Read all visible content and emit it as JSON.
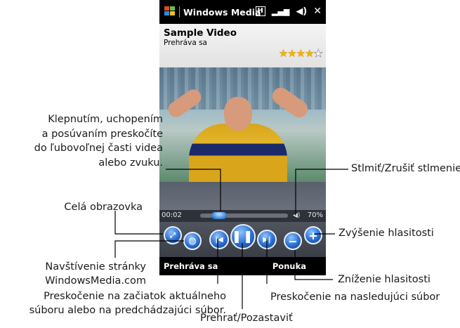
{
  "titlebar": {
    "app_name": "Windows Media",
    "close_glyph": "✕"
  },
  "media": {
    "title": "Sample Video",
    "status": "Prehráva sa",
    "rating": 4,
    "rating_max": 5
  },
  "playback": {
    "elapsed": "00:02",
    "volume_label": "70%",
    "volume": 0.7
  },
  "softkeys": {
    "left": "Prehráva sa",
    "right": "Ponuka"
  },
  "callouts": {
    "seek": [
      "Klepnutím, uchopením",
      "a posúvaním preskočíte",
      "do ľubovoľnej časti videa",
      "alebo zvuku."
    ],
    "fullscreen": "Celá obrazovka",
    "website": [
      "Navštívenie stránky",
      "WindowsMedia.com"
    ],
    "previous": [
      "Preskočenie na začiatok aktuálneho",
      "súboru alebo na predchádzajúci súbor."
    ],
    "play_pause": "Prehrať/Pozastaviť",
    "next": "Preskočenie na nasledujúci súbor",
    "mute": "Stlmiť/Zrušiť stlmenie",
    "volume_up": "Zvýšenie hlasitosti",
    "volume_down": "Zníženie hlasitosti"
  },
  "colors": {
    "accent_blue": "#2a6fd0",
    "star": "#f0b400",
    "bar": "#000000"
  }
}
